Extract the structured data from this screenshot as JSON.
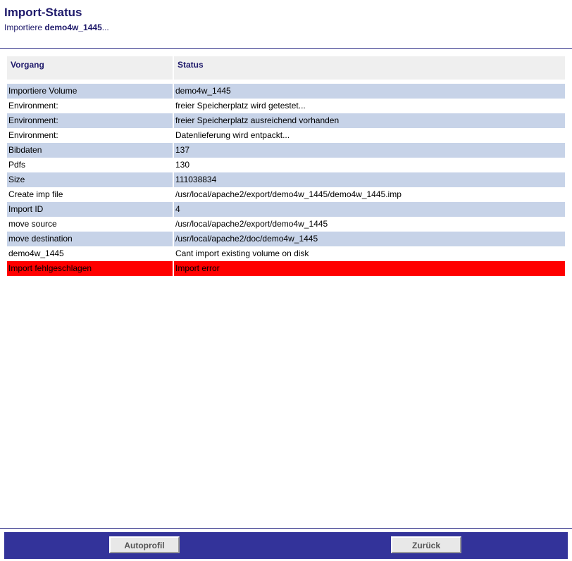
{
  "header": {
    "title": "Import-Status",
    "subtitle_prefix": "Importiere ",
    "subtitle_volume": "demo4w_1445",
    "subtitle_suffix": "..."
  },
  "table": {
    "columns": [
      "Vorgang",
      "Status"
    ],
    "rows": [
      {
        "vorgang": "Importiere Volume",
        "status": "demo4w_1445"
      },
      {
        "vorgang": "Environment:",
        "status": "freier Speicherplatz wird getestet..."
      },
      {
        "vorgang": "Environment:",
        "status": "freier Speicherplatz ausreichend vorhanden"
      },
      {
        "vorgang": "Environment:",
        "status": "Datenlieferung wird entpackt..."
      },
      {
        "vorgang": "Bibdaten",
        "status": "137"
      },
      {
        "vorgang": "Pdfs",
        "status": "130"
      },
      {
        "vorgang": "Size",
        "status": "111038834"
      },
      {
        "vorgang": "Create imp file",
        "status": "/usr/local/apache2/export/demo4w_1445/demo4w_1445.imp"
      },
      {
        "vorgang": "Import ID",
        "status": "4"
      },
      {
        "vorgang": "move source",
        "status": "/usr/local/apache2/export/demo4w_1445"
      },
      {
        "vorgang": "move destination",
        "status": "/usr/local/apache2/doc/demo4w_1445"
      },
      {
        "vorgang": "demo4w_1445",
        "status": "Cant import existing volume on disk"
      },
      {
        "vorgang": "Import fehlgeschlagen",
        "status": "Import error"
      }
    ]
  },
  "footer": {
    "autoprofil_label": "Autoprofil",
    "zurueck_label": "Zurück"
  },
  "colors": {
    "brand_navy": "#1f1a6b",
    "footer_bar": "#33339a",
    "row_alt": "#c7d3e8",
    "error_row": "#ff0000",
    "header_cell": "#efefef"
  }
}
